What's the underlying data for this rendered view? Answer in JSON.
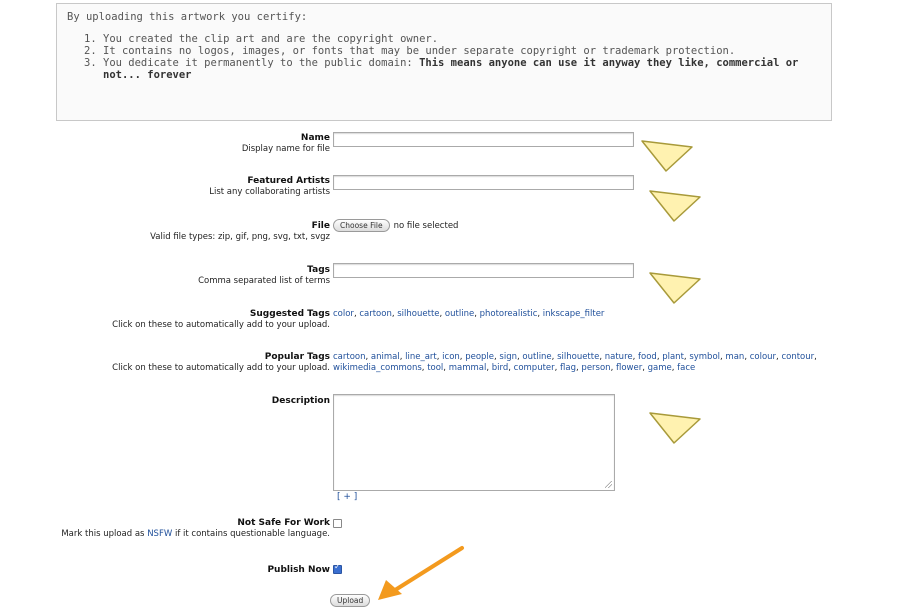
{
  "certify": {
    "intro": "By uploading this artwork you certify:",
    "items": [
      "You created the clip art and are the copyright owner.",
      "It contains no logos, images, or fonts that may be under separate copyright or trademark protection."
    ],
    "item3_prefix": "You dedicate it permanently to the public domain: ",
    "item3_bold": "This means anyone can use it anyway they like, commercial or not... forever"
  },
  "name": {
    "label": "Name",
    "sub": "Display name for file",
    "value": ""
  },
  "artists": {
    "label": "Featured Artists",
    "sub": "List any collaborating artists",
    "value": ""
  },
  "file": {
    "label": "File",
    "sub": "Valid file types: zip, gif, png, svg, txt, svgz",
    "button": "Choose File",
    "status": "no file selected"
  },
  "tags": {
    "label": "Tags",
    "sub": "Comma separated list of terms",
    "value": ""
  },
  "suggested": {
    "label": "Suggested Tags",
    "sub": "Click on these to automatically add to your upload.",
    "items": [
      "color",
      "cartoon",
      "silhouette",
      "outline",
      "photorealistic",
      "inkscape_filter"
    ]
  },
  "popular": {
    "label": "Popular Tags",
    "sub": "Click on these to automatically add to your upload.",
    "line1": [
      "cartoon",
      "animal",
      "line_art",
      "icon",
      "people",
      "sign",
      "outline",
      "silhouette",
      "nature",
      "food",
      "plant",
      "symbol",
      "man",
      "colour",
      "contour"
    ],
    "line2": [
      "wikimedia_commons",
      "tool",
      "mammal",
      "bird",
      "computer",
      "flag",
      "person",
      "flower",
      "game",
      "face"
    ]
  },
  "description": {
    "label": "Description",
    "expand": "[ + ]",
    "value": ""
  },
  "nsfw": {
    "label": "Not Safe For Work",
    "sub_prefix": "Mark this upload as ",
    "sub_link": "NSFW",
    "sub_suffix": " if it contains questionable language.",
    "checked": false
  },
  "publish": {
    "label": "Publish Now",
    "checked": true
  },
  "upload_button": "Upload",
  "colors": {
    "link": "#1f4f9a",
    "arrow_yellow": "#fff2b0",
    "arrow_orange": "#f39a1e"
  }
}
